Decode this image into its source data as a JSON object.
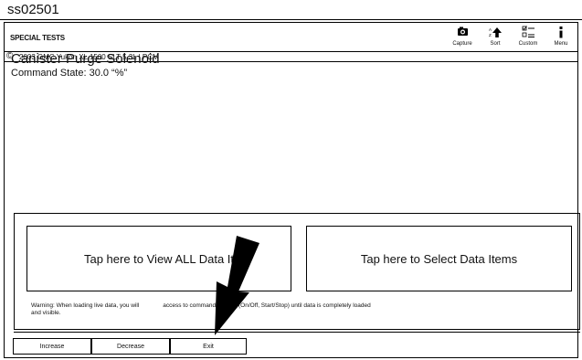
{
  "figure_id": "ss02501",
  "header": {
    "title": "SPECIAL TESTS"
  },
  "toolbar": [
    {
      "label": "Capture",
      "icon": "camera-icon"
    },
    {
      "label": "Sort",
      "icon": "sort-icon"
    },
    {
      "label": "Custom",
      "icon": "custom-list-icon"
    },
    {
      "label": "Menu",
      "icon": "menu-icon"
    }
  ],
  "vehicle": {
    "copyright": "©",
    "text": "2003 GMC Yukon XL 1500 SLT 5.3L | PCM"
  },
  "test": {
    "name": "Canister Purge Solenoid",
    "command_state": "Command State:  30.0 “%”"
  },
  "panel": {
    "view_all": "Tap here to View ALL Data It",
    "select_items": "Tap here to Select Data Items",
    "warning_line1": "Warning: When loading live data, you will",
    "warning_line1b": "access to command buttons (On/Off, Start/Stop) until data is completely loaded",
    "warning_line2": "and visible."
  },
  "bottom_buttons": {
    "increase": "Increase",
    "decrease": "Decrease",
    "exit": "Exit"
  }
}
